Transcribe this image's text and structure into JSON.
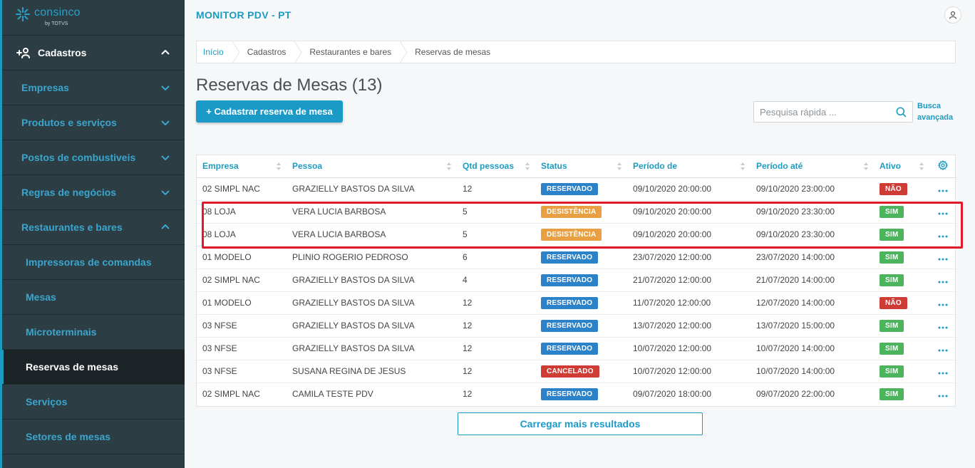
{
  "brand": {
    "name": "consinco",
    "sub": "by TOTVS"
  },
  "sidebar": {
    "header": {
      "label": "Cadastros",
      "icon": "add-user-icon"
    },
    "items": [
      {
        "label": "Empresas",
        "type": "section",
        "expanded": false
      },
      {
        "label": "Produtos e serviços",
        "type": "section",
        "expanded": false
      },
      {
        "label": "Postos de combustiveis",
        "type": "section",
        "expanded": false
      },
      {
        "label": "Regras de negócios",
        "type": "section",
        "expanded": false
      },
      {
        "label": "Restaurantes e bares",
        "type": "section",
        "expanded": true
      },
      {
        "label": "Impressoras de comandas",
        "type": "sub"
      },
      {
        "label": "Mesas",
        "type": "sub"
      },
      {
        "label": "Microterminais",
        "type": "sub"
      },
      {
        "label": "Reservas de mesas",
        "type": "sub",
        "active": true
      },
      {
        "label": "Serviços",
        "type": "sub"
      },
      {
        "label": "Setores de mesas",
        "type": "sub"
      }
    ]
  },
  "header": {
    "app_title": "MONITOR PDV - PT"
  },
  "breadcrumb": [
    "Início",
    "Cadastros",
    "Restaurantes e bares",
    "Reservas de mesas"
  ],
  "page": {
    "title": "Reservas de Mesas (13)",
    "add_button": "+ Cadastrar reserva de mesa",
    "search_placeholder": "Pesquisa rápida ...",
    "advanced_search_line1": "Busca",
    "advanced_search_line2": "avançada",
    "load_more": "Carregar mais resultados"
  },
  "table": {
    "columns": [
      "Empresa",
      "Pessoa",
      "Qtd pessoas",
      "Status",
      "Período de",
      "Período até",
      "Ativo"
    ],
    "rows": [
      {
        "empresa": "02 SIMPL NAC",
        "pessoa": "GRAZIELLY BASTOS DA SILVA",
        "qtd": "12",
        "status": "RESERVADO",
        "status_type": "res",
        "de": "09/10/2020 20:00:00",
        "ate": "09/10/2020 23:00:00",
        "ativo": "NÃO",
        "ativo_type": "nao"
      },
      {
        "empresa": "08 LOJA",
        "pessoa": "VERA LUCIA BARBOSA",
        "qtd": "5",
        "status": "DESISTÊNCIA",
        "status_type": "des",
        "de": "09/10/2020 20:00:00",
        "ate": "09/10/2020 23:30:00",
        "ativo": "SIM",
        "ativo_type": "sim"
      },
      {
        "empresa": "08 LOJA",
        "pessoa": "VERA LUCIA BARBOSA",
        "qtd": "5",
        "status": "DESISTÊNCIA",
        "status_type": "des",
        "de": "09/10/2020 20:00:00",
        "ate": "09/10/2020 23:30:00",
        "ativo": "SIM",
        "ativo_type": "sim"
      },
      {
        "empresa": "01 MODELO",
        "pessoa": "PLINIO ROGERIO PEDROSO",
        "qtd": "6",
        "status": "RESERVADO",
        "status_type": "res",
        "de": "23/07/2020 12:00:00",
        "ate": "23/07/2020 14:00:00",
        "ativo": "SIM",
        "ativo_type": "sim"
      },
      {
        "empresa": "02 SIMPL NAC",
        "pessoa": "GRAZIELLY BASTOS DA SILVA",
        "qtd": "4",
        "status": "RESERVADO",
        "status_type": "res",
        "de": "21/07/2020 12:00:00",
        "ate": "21/07/2020 14:00:00",
        "ativo": "SIM",
        "ativo_type": "sim"
      },
      {
        "empresa": "01 MODELO",
        "pessoa": "GRAZIELLY BASTOS DA SILVA",
        "qtd": "12",
        "status": "RESERVADO",
        "status_type": "res",
        "de": "11/07/2020 12:00:00",
        "ate": "12/07/2020 14:00:00",
        "ativo": "NÃO",
        "ativo_type": "nao"
      },
      {
        "empresa": "03 NFSE",
        "pessoa": "GRAZIELLY BASTOS DA SILVA",
        "qtd": "12",
        "status": "RESERVADO",
        "status_type": "res",
        "de": "13/07/2020 12:00:00",
        "ate": "13/07/2020 15:00:00",
        "ativo": "SIM",
        "ativo_type": "sim"
      },
      {
        "empresa": "03 NFSE",
        "pessoa": "GRAZIELLY BASTOS DA SILVA",
        "qtd": "12",
        "status": "RESERVADO",
        "status_type": "res",
        "de": "10/07/2020 12:00:00",
        "ate": "10/07/2020 14:00:00",
        "ativo": "SIM",
        "ativo_type": "sim"
      },
      {
        "empresa": "03 NFSE",
        "pessoa": "SUSANA REGINA DE JESUS",
        "qtd": "12",
        "status": "CANCELADO",
        "status_type": "can",
        "de": "10/07/2020 12:00:00",
        "ate": "10/07/2020 14:00:00",
        "ativo": "SIM",
        "ativo_type": "sim"
      },
      {
        "empresa": "02 SIMPL NAC",
        "pessoa": "CAMILA TESTE PDV",
        "qtd": "12",
        "status": "RESERVADO",
        "status_type": "res",
        "de": "09/07/2020 18:00:00",
        "ate": "09/07/2020 22:00:00",
        "ativo": "SIM",
        "ativo_type": "sim"
      }
    ]
  },
  "colors": {
    "accent": "#1d9bbf",
    "sidebar": "#2c3d43",
    "reservado": "#2c82c9",
    "desistencia": "#e8a043",
    "cancelado": "#cf3b35",
    "sim": "#4cb45c",
    "nao": "#cf3b35",
    "highlight": "#e3182a"
  }
}
